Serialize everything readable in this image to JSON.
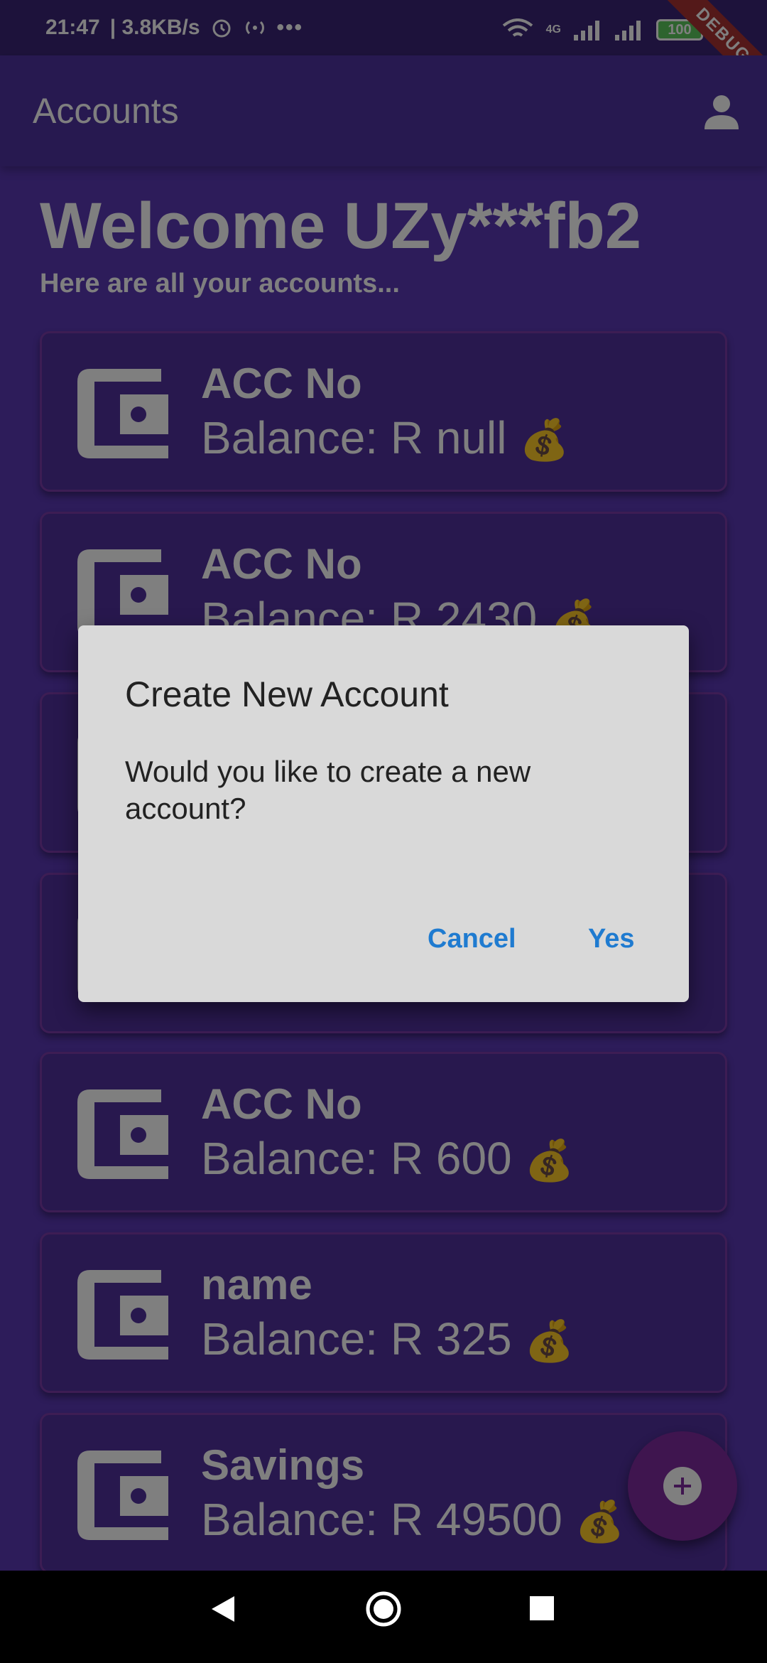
{
  "status_bar": {
    "time": "21:47",
    "speed": "| 3.8KB/s",
    "network": "4G",
    "battery": "100",
    "debug_banner": "DEBUG"
  },
  "app_bar": {
    "title": "Accounts",
    "profile_icon": "person-icon"
  },
  "welcome": {
    "title": "Welcome UZy***fb2",
    "subtitle": "Here are all your accounts..."
  },
  "accounts": [
    {
      "name": "ACC No",
      "balance": "Balance: R null",
      "icon": "wallet-icon"
    },
    {
      "name": "ACC No",
      "balance": "Balance: R 2430",
      "icon": "wallet-icon"
    },
    {
      "name": "",
      "balance": "",
      "icon": "wallet-icon"
    },
    {
      "name": "",
      "balance": "",
      "icon": "wallet-icon"
    },
    {
      "name": "ACC No",
      "balance": "Balance: R 600",
      "icon": "wallet-icon"
    },
    {
      "name": "name",
      "balance": "Balance: R 325",
      "icon": "wallet-icon"
    },
    {
      "name": "Savings",
      "balance": "Balance: R 49500",
      "icon": "wallet-icon"
    }
  ],
  "money_bag_emoji": "💰",
  "fab": {
    "icon": "add-circle-icon"
  },
  "dialog": {
    "title": "Create New Account",
    "message": "Would you like to create a new account?",
    "cancel_label": "Cancel",
    "yes_label": "Yes"
  },
  "nav_bar": {
    "back_icon": "back-icon",
    "home_icon": "home-icon",
    "recents_icon": "recents-icon"
  },
  "colors": {
    "background": "#5a38b4",
    "app_bar": "#4f32a0",
    "card": "#50309c",
    "card_border": "#7a3aa8",
    "fab": "#7e2a9e",
    "dialog_bg": "#d9d9d9",
    "dialog_button": "#1f7bd0"
  }
}
